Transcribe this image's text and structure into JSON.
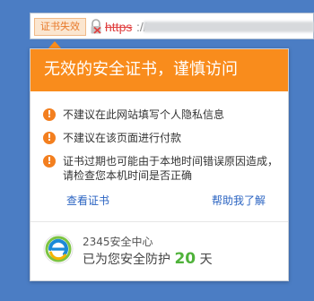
{
  "address_bar": {
    "cert_badge": "证书失效",
    "url_scheme": "https",
    "url_sep": "://"
  },
  "popup": {
    "title": "无效的安全证书，谨慎访问",
    "warnings": [
      "不建议在此网站填写个人隐私信息",
      "不建议在该页面进行付款",
      "证书过期也可能由于本地时间错误原因造成，请检查您本机时间是否正确"
    ],
    "view_cert_link": "查看证书",
    "help_link": "帮助我了解"
  },
  "footer": {
    "product_name": "2345安全中心",
    "protect_prefix": "已为您安全防护",
    "protect_days": "20",
    "protect_suffix": "天"
  },
  "colors": {
    "accent_orange": "#f98c1c",
    "link_blue": "#2b64c2",
    "warn_red": "#e04141",
    "days_green": "#4fb23a",
    "background_blue": "#4b7dc4"
  }
}
